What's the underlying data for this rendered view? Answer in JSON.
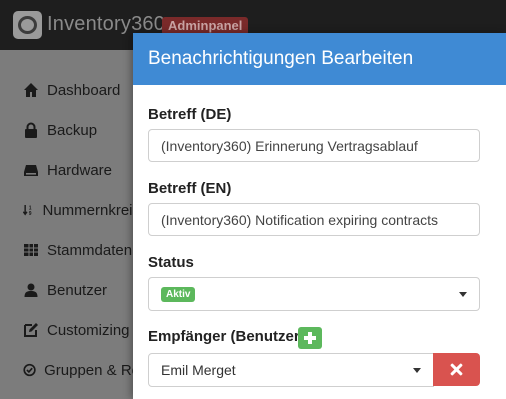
{
  "header": {
    "brand": "Inventory360",
    "badge": "Adminpanel"
  },
  "sidebar": {
    "items": [
      {
        "label": "Dashboard",
        "icon": "home-icon"
      },
      {
        "label": "Backup",
        "icon": "lock-icon"
      },
      {
        "label": "Hardware",
        "icon": "hard-drive-icon"
      },
      {
        "label": "Nummernkreis",
        "icon": "sort-numeric-icon"
      },
      {
        "label": "Stammdaten",
        "icon": "table-icon"
      },
      {
        "label": "Benutzer",
        "icon": "user-icon"
      },
      {
        "label": "Customizing",
        "icon": "edit-icon"
      },
      {
        "label": "Gruppen & Re",
        "icon": "check-circle-icon"
      }
    ]
  },
  "modal": {
    "title": "Benachrichtigungen Bearbeiten",
    "subject_de_label": "Betreff (DE)",
    "subject_de_value": "(Inventory360) Erinnerung Vertragsablauf",
    "subject_en_label": "Betreff (EN)",
    "subject_en_value": "(Inventory360) Notification expiring contracts",
    "status_label": "Status",
    "status_value": "Aktiv",
    "recipients_label": "Empfänger (Benutzer)",
    "recipient_value": "Emil Merget"
  },
  "colors": {
    "header_blue": "#3f8ad4",
    "success_green": "#5cb85c",
    "danger_red": "#d9534f"
  }
}
